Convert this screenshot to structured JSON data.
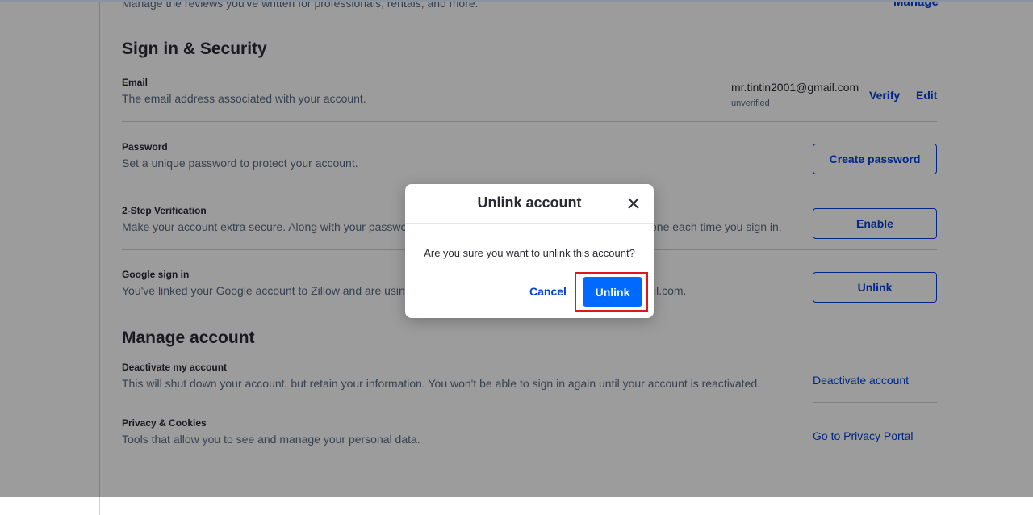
{
  "header": {
    "reviews_description": "Manage the reviews you've written for professionals, rentals, and more.",
    "reviews_link": "Manage"
  },
  "sign_in_security": {
    "title": "Sign in & Security",
    "email": {
      "label": "Email",
      "description": "The email address associated with your account.",
      "value": "mr.tintin2001@gmail.com",
      "status": "unverified",
      "verify_link": "Verify",
      "edit_link": "Edit"
    },
    "password": {
      "label": "Password",
      "description": "Set a unique password to protect your account.",
      "button": "Create password"
    },
    "two_step": {
      "label": "2-Step Verification",
      "description_start": "Make your account extra secure. Along with your password",
      "description_end": "one each time you sign in.",
      "button": "Enable"
    },
    "google": {
      "label": "Google sign in",
      "description_start": "You've linked your Google account to Zillow and are using i",
      "description_end": "il.com.",
      "button": "Unlink"
    }
  },
  "manage_account": {
    "title": "Manage account",
    "deactivate": {
      "label": "Deactivate my account",
      "description": "This will shut down your account, but retain your information. You won't be able to sign in again until your account is reactivated.",
      "link": "Deactivate account"
    },
    "privacy": {
      "label": "Privacy & Cookies",
      "description": "Tools that allow you to see and manage your personal data.",
      "link": "Go to Privacy Portal"
    }
  },
  "modal": {
    "title": "Unlink account",
    "message": "Are you sure you want to unlink this account?",
    "cancel": "Cancel",
    "confirm": "Unlink",
    "close_icon": "close-icon"
  },
  "colors": {
    "primary": "#006aff",
    "link": "#0041d9",
    "highlight": "#e0161e"
  }
}
